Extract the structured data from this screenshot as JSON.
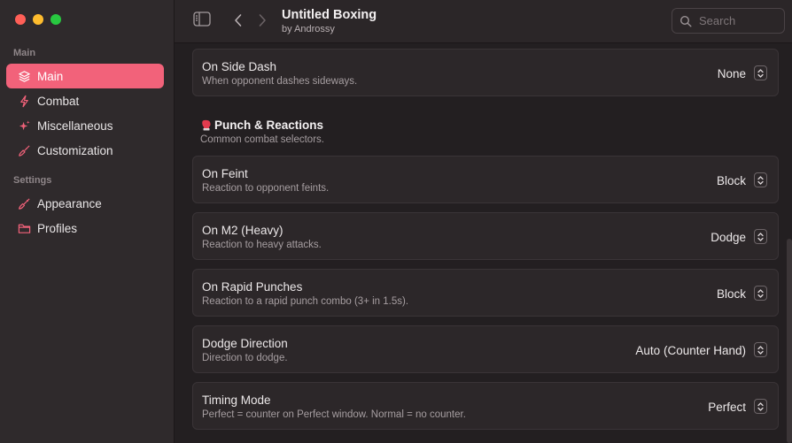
{
  "window": {
    "title": "Untitled Boxing",
    "subtitle": "by Androssy"
  },
  "search": {
    "placeholder": "Search"
  },
  "sidebar": {
    "sections": [
      {
        "label": "Main",
        "items": [
          {
            "label": "Main",
            "icon": "layers-icon",
            "active": true
          },
          {
            "label": "Combat",
            "icon": "bolt-icon",
            "active": false
          },
          {
            "label": "Miscellaneous",
            "icon": "sparkle-icon",
            "active": false
          },
          {
            "label": "Customization",
            "icon": "brush-icon",
            "active": false
          }
        ]
      },
      {
        "label": "Settings",
        "items": [
          {
            "label": "Appearance",
            "icon": "paintbrush-icon",
            "active": false
          },
          {
            "label": "Profiles",
            "icon": "folder-icon",
            "active": false
          }
        ]
      }
    ]
  },
  "settings": [
    {
      "title": "On Side Dash",
      "description": "When opponent dashes sideways.",
      "value": "None"
    },
    {
      "title": "On Feint",
      "description": "Reaction to opponent feints.",
      "value": "Block"
    },
    {
      "title": "On M2 (Heavy)",
      "description": "Reaction to heavy attacks.",
      "value": "Dodge"
    },
    {
      "title": "On Rapid Punches",
      "description": "Reaction to a rapid punch combo (3+ in 1.5s).",
      "value": "Block"
    },
    {
      "title": "Dodge Direction",
      "description": "Direction to dodge.",
      "value": "Auto (Counter Hand)"
    },
    {
      "title": "Timing Mode",
      "description": "Perfect = counter on Perfect window. Normal = no counter.",
      "value": "Perfect"
    }
  ],
  "section": {
    "title": "Punch & Reactions",
    "subtitle": "Common combat selectors.",
    "icon": "boxing-glove-icon"
  },
  "colors": {
    "accent": "#f2627a",
    "sidebar_bg": "#2f2a2c",
    "content_bg": "#231f21"
  }
}
